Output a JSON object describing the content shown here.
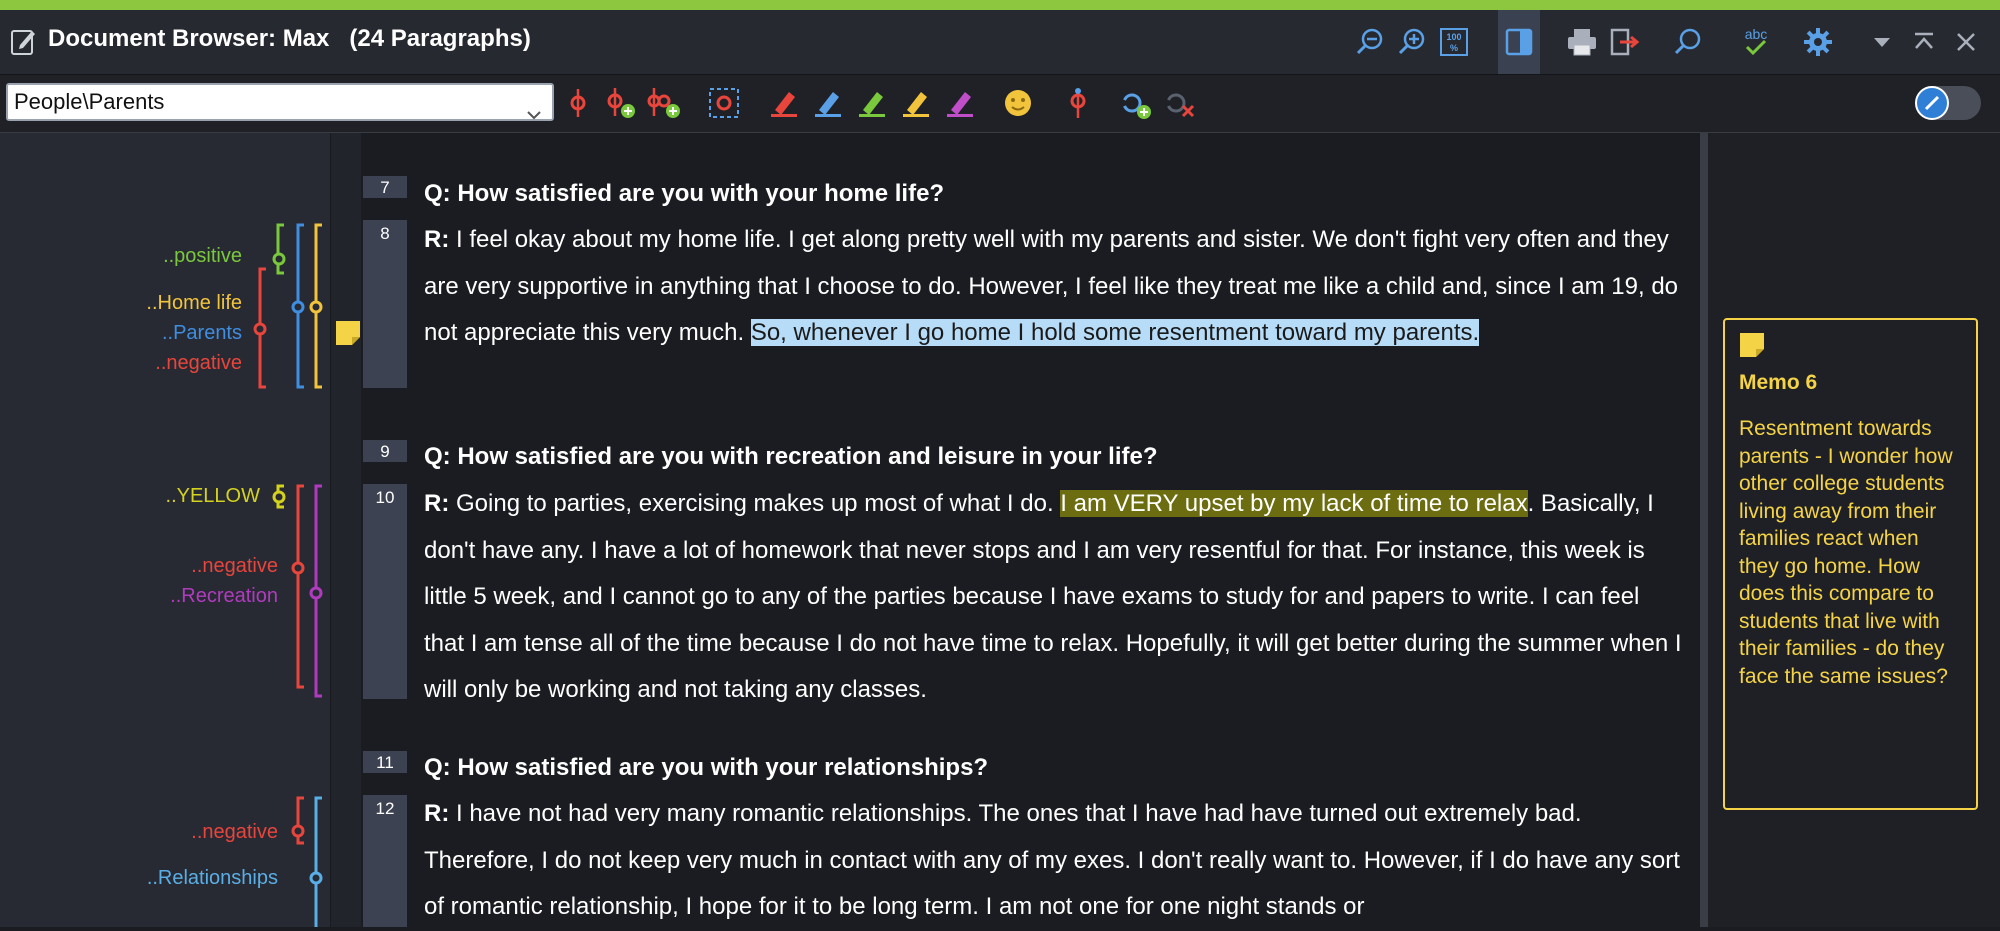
{
  "window": {
    "title": "Document Browser: Max",
    "paragraph_count": "(24 Paragraphs)"
  },
  "titlebar_icons": [
    "zoom-out-icon",
    "zoom-in-icon",
    "zoom-100-icon",
    "panel-icon",
    "print-icon",
    "export-icon",
    "search-icon",
    "spellcheck-icon",
    "gear-icon",
    "chevron-down-icon",
    "pin-top-icon",
    "close-icon"
  ],
  "toolbar": {
    "code_select_value": "People\\Parents",
    "highlight_colors": [
      "#e8453c",
      "#5aa0e6",
      "#7ac83b",
      "#f2c43b",
      "#c04ec9"
    ],
    "toggle_on": true
  },
  "codes": [
    {
      "label": "..positive",
      "color": "#7ac83b"
    },
    {
      "label": "..Home life",
      "color": "#f2c43b"
    },
    {
      "label": "..Parents",
      "color": "#3f8ee0"
    },
    {
      "label": "..negative",
      "color": "#e8453c"
    },
    {
      "label": "..YELLOW",
      "color": "#d4d21c"
    },
    {
      "label": "..negative",
      "color": "#e8453c"
    },
    {
      "label": "..Recreation",
      "color": "#b13bbf"
    },
    {
      "label": "..negative",
      "color": "#e8453c"
    },
    {
      "label": "..Relationships",
      "color": "#5aaee6"
    }
  ],
  "paragraphs": [
    {
      "num": "7",
      "bold": "Q: How satisfied are you with your home life?",
      "text": ""
    },
    {
      "num": "8",
      "bold": "R:",
      "text_before": " I feel okay about my home life. I get along pretty well with my parents and sister. We don't fight very often and they are very supportive in anything that I choose to do. However, I feel like they treat me like a child and, since I am 19, do not appreciate this very much. ",
      "highlight": "So, whenever I go home I hold some resentment toward my parents. ",
      "text_after": ""
    },
    {
      "num": "9",
      "bold": "Q: How satisfied are you with recreation and leisure in your life?",
      "text": ""
    },
    {
      "num": "10",
      "bold": "R:",
      "text_before": " Going to parties, exercising makes up most of what I do. ",
      "highlight": "I am VERY upset by my lack of time to relax",
      "text_after": ". Basically, I don't have any. I have a lot of homework that never stops and I am very resentful for that. For instance, this week is little 5 week, and I cannot go to any of the parties because I have exams to study for and papers to write. I can feel that I am tense all of the time because I do not have time to relax. Hopefully, it will get better during the summer when I will only be working and not taking any classes."
    },
    {
      "num": "11",
      "bold": "Q: How satisfied are you with your relationships?",
      "text": ""
    },
    {
      "num": "12",
      "bold": "R:",
      "text_before": " I have not had very many romantic relationships. The ones that I have had have turned out extremely bad. Therefore, I do not keep very much in contact with any of my exes. I don't really want to. However, if I do have any sort of romantic relationship, I hope for it to be long term. I am not one for one night stands or",
      "highlight": "",
      "text_after": ""
    }
  ],
  "memo": {
    "title": "Memo 6",
    "body": "Resentment towards parents - I wonder how other college students living away from their families react when they go home. How does this compare to students that live with their families - do they face the same issues?",
    "color": "#f5d347"
  }
}
